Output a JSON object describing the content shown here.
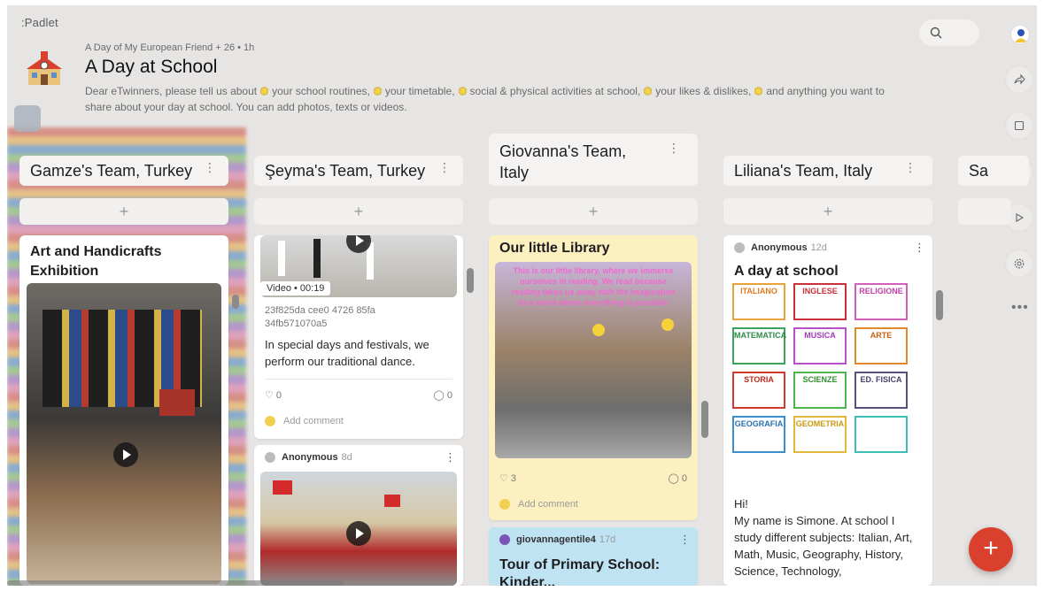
{
  "app": {
    "logo": ":Padlet",
    "meta": "A Day of My European Friend  + 26  • 1h",
    "title": "A Day at School",
    "description": [
      "Dear eTwinners, please tell us about",
      "your school routines,",
      "your timetable,",
      "social & physical activities at school,",
      "your likes & dislikes,",
      "and anything you want to share about your day at school. You can add photos, texts or videos."
    ]
  },
  "sidebar": {
    "icons": [
      "share-icon",
      "remix-icon",
      "bell-icon",
      "slideshow-icon",
      "settings-icon"
    ],
    "more": "•••"
  },
  "columns": [
    {
      "title": "Gamze's Team, Turkey",
      "add": "+",
      "cards": [
        {
          "title": "Art and Handicrafts Exhibition"
        }
      ]
    },
    {
      "title": "Şeyma's Team, Turkey",
      "add": "+",
      "cards": [
        {
          "video_label": "Video • 00:19",
          "filename": "23f825da cee0 4726 85fa 34fb571070a5",
          "body": "In special days and festivals, we perform our traditional dance.",
          "likes": "0",
          "comments": "0",
          "add_comment": "Add comment"
        },
        {
          "author": "Anonymous",
          "time": "8d"
        }
      ]
    },
    {
      "title": "Giovanna's Team, Italy",
      "add": "+",
      "cards": [
        {
          "title": "Our little Library",
          "image_caption": "This is our little library, where we immerse ourselves in reading. We read because reading takes us away with the imagination to a world where everything is possible",
          "likes": "3",
          "comments": "0",
          "add_comment": "Add comment"
        },
        {
          "author": "giovannagentile4",
          "time": "17d",
          "title": "Tour of Primary School:",
          "partial": "Kinder..."
        }
      ]
    },
    {
      "title": "Liliana's Team, Italy",
      "add": "+",
      "cards": [
        {
          "author": "Anonymous",
          "time": "12d",
          "title": "A day at school",
          "subjects": [
            "ITALIANO",
            "INGLESE",
            "RELIGIONE",
            "MATEMATICA",
            "MUSICA",
            "ARTE",
            "STORIA",
            "SCIENZE",
            "ED. FISICA",
            "GEOGRAFIA",
            "GEOMETRIA",
            ""
          ],
          "body": "Hi!\nMy name is Simone. At school I study different subjects: Italian, Art, Math, Music, Geography, History, Science, Technology,"
        }
      ]
    },
    {
      "title": "Sa",
      "add": "+"
    }
  ],
  "colors": {
    "background": "#e7e5e3",
    "fab": "#d9412e",
    "yellow_card": "#fdf0c0",
    "blue_card": "#bfe3f3"
  },
  "fab": {
    "label": "+"
  }
}
